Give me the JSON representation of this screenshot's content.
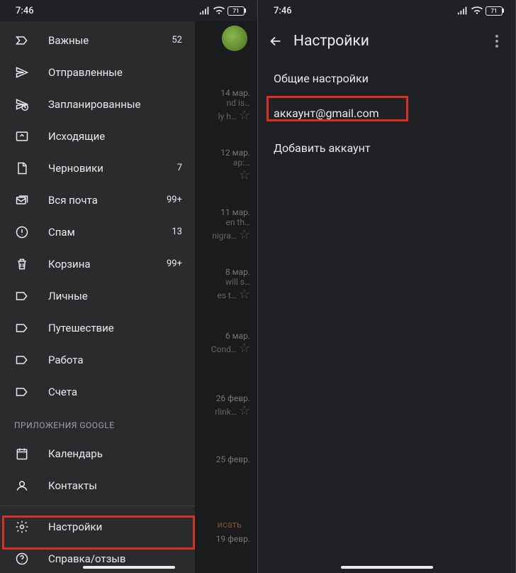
{
  "status": {
    "time": "7:46",
    "battery": "71"
  },
  "drawer": {
    "items": [
      {
        "icon": "important",
        "label": "Важные",
        "count": "52"
      },
      {
        "icon": "sent",
        "label": "Отправленные",
        "count": ""
      },
      {
        "icon": "scheduled",
        "label": "Запланированные",
        "count": ""
      },
      {
        "icon": "outbox",
        "label": "Исходящие",
        "count": ""
      },
      {
        "icon": "drafts",
        "label": "Черновики",
        "count": "7"
      },
      {
        "icon": "allmail",
        "label": "Вся почта",
        "count": "99+"
      },
      {
        "icon": "spam",
        "label": "Спам",
        "count": "13"
      },
      {
        "icon": "trash",
        "label": "Корзина",
        "count": "99+"
      },
      {
        "icon": "label",
        "label": "Личные",
        "count": ""
      },
      {
        "icon": "label",
        "label": "Путешествие",
        "count": ""
      },
      {
        "icon": "label",
        "label": "Работа",
        "count": ""
      },
      {
        "icon": "label",
        "label": "Счета",
        "count": ""
      }
    ],
    "section_apps": "ПРИЛОЖЕНИЯ GOOGLE",
    "apps": [
      {
        "icon": "calendar",
        "label": "Календарь"
      },
      {
        "icon": "contacts",
        "label": "Контакты"
      }
    ],
    "bottom": [
      {
        "icon": "settings",
        "label": "Настройки"
      },
      {
        "icon": "help",
        "label": "Справка/отзыв"
      }
    ]
  },
  "inbox_bg": {
    "rows": [
      {
        "date": "14 мар.",
        "snip1": "nd is…",
        "snip2": "ly h…"
      },
      {
        "date": "12 мар.",
        "snip1": "ар:…"
      },
      {
        "date": "11 мар.",
        "snip1": "en th…",
        "snip2": "nigra…"
      },
      {
        "date": "8 мар.",
        "snip1": "will s…",
        "snip2": "es t…"
      },
      {
        "date": "6 мар.",
        "snip1": "Cond…"
      },
      {
        "date": "26 февр.",
        "snip1": "rlink…"
      },
      {
        "date": "25 февр."
      },
      {
        "date": "19 февр."
      }
    ],
    "compose": "исать"
  },
  "settings": {
    "title": "Настройки",
    "items": [
      "Общие настройки",
      "аккаунт@gmail.com",
      "Добавить аккаунт"
    ]
  }
}
